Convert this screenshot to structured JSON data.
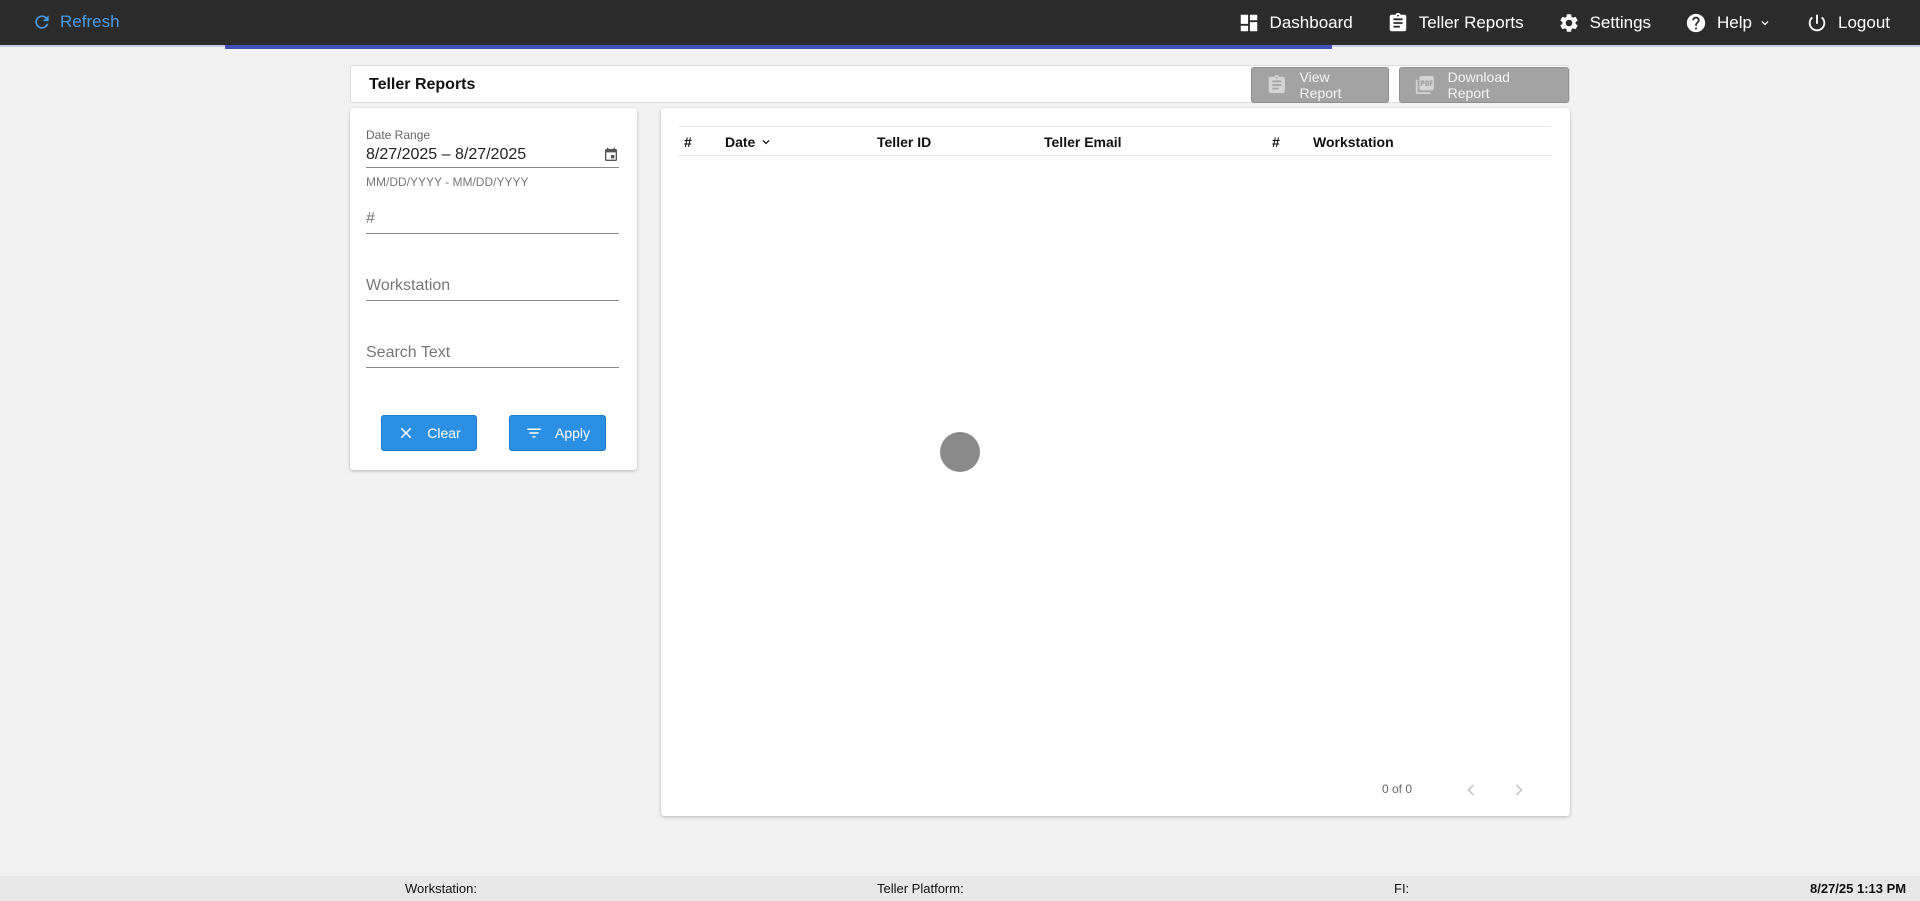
{
  "topbar": {
    "refresh_label": "Refresh",
    "nav": [
      {
        "label": "Dashboard",
        "icon": "dashboard-icon"
      },
      {
        "label": "Teller Reports",
        "icon": "clipboard-icon"
      },
      {
        "label": "Settings",
        "icon": "gear-icon"
      },
      {
        "label": "Help",
        "icon": "help-icon"
      },
      {
        "label": "Logout",
        "icon": "power-icon"
      }
    ],
    "accent_color": "#3f51b5",
    "link_color": "#4a9be6"
  },
  "titlebar": {
    "title": "Teller Reports",
    "view_report_label": "View Report",
    "download_report_label": "Download Report"
  },
  "filters": {
    "date_range_label": "Date Range",
    "date_range_value": "8/27/2025 – 8/27/2025",
    "date_range_hint": "MM/DD/YYYY - MM/DD/YYYY",
    "number_placeholder": "#",
    "workstation_placeholder": "Workstation",
    "search_placeholder": "Search Text",
    "clear_label": "Clear",
    "apply_label": "Apply",
    "button_color": "#2b8fe3"
  },
  "table": {
    "columns": [
      "#",
      "Date",
      "Teller ID",
      "Teller Email",
      "#",
      "Workstation"
    ],
    "rows": [],
    "pagination": "0 of 0"
  },
  "footer": {
    "workstation": "Workstation:",
    "platform": "Teller Platform:",
    "fi": "FI:",
    "datetime": "8/27/25 1:13 PM"
  }
}
